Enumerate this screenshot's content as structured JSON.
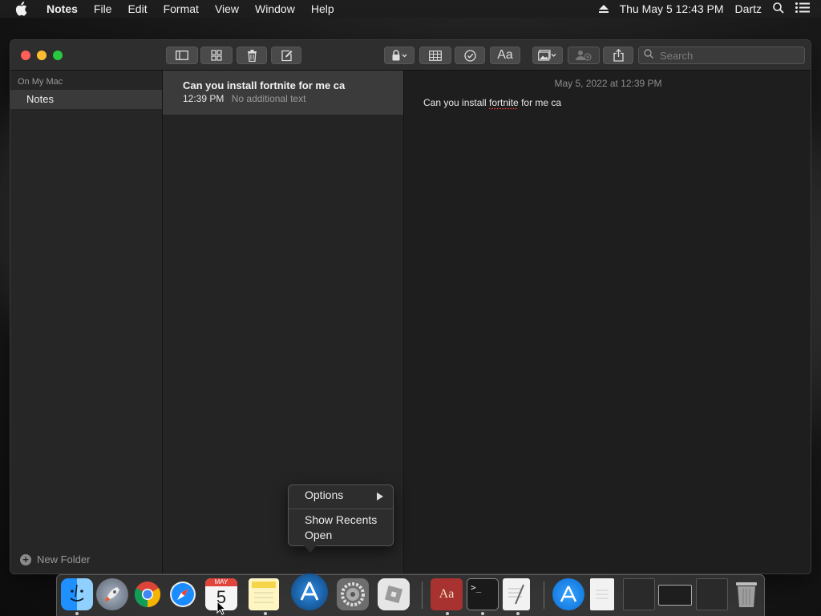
{
  "menubar": {
    "app_name": "Notes",
    "items": [
      "File",
      "Edit",
      "Format",
      "View",
      "Window",
      "Help"
    ],
    "clock": "Thu May 5  12:43 PM",
    "user": "Dartz"
  },
  "toolbar": {
    "search_placeholder": "Search",
    "format_label": "Aa"
  },
  "sidebar": {
    "section_header": "On My Mac",
    "folders": [
      {
        "label": "Notes",
        "selected": true
      }
    ],
    "new_folder_label": "New Folder"
  },
  "notes_list": [
    {
      "title": "Can you install fortnite for me ca",
      "time": "12:39 PM",
      "preview": "No additional text",
      "selected": true
    }
  ],
  "editor": {
    "date": "May 5, 2022 at 12:39 PM",
    "body_before": "Can you install ",
    "body_misspelled": "fortnite",
    "body_after": " for me ca"
  },
  "context_menu": {
    "items": [
      "Options",
      "Show Recents",
      "Open"
    ]
  },
  "dock": {
    "calendar_month": "MAY",
    "calendar_day": "5",
    "apps": [
      "Finder",
      "Launchpad",
      "Google Chrome",
      "Safari",
      "Calendar",
      "Notes",
      "Xcode",
      "System Preferences",
      "Roblox",
      "Dictionary",
      "Terminal",
      "TextEdit",
      "App Store",
      "Document",
      "Window",
      "Window",
      "Window",
      "Trash"
    ]
  },
  "colors": {
    "close": "#fe5f57",
    "minimize": "#febc2e",
    "zoom": "#28c840",
    "selection": "#3a3a3a"
  }
}
